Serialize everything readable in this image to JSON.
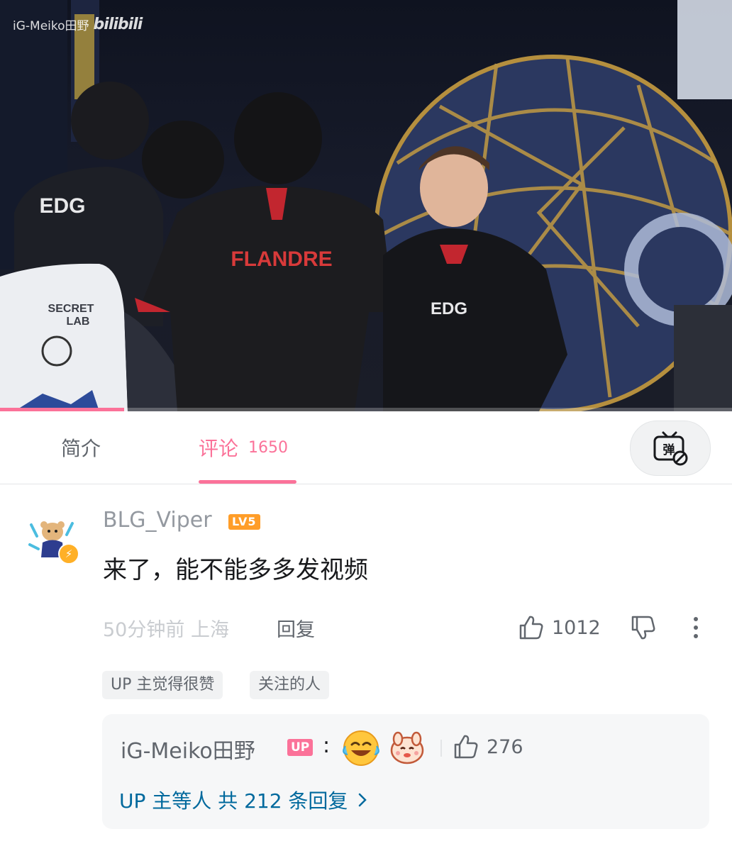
{
  "video": {
    "watermark_user": "iG-Meiko田野",
    "watermark_brand": "bilibili",
    "jersey_name": "FLANDRE",
    "team_logo": "EDG",
    "chair_brand_line1": "SECRET",
    "chair_brand_line2": "LAB",
    "progress_fraction": 0.17
  },
  "tabs": {
    "intro_label": "简介",
    "comments_label": "评论",
    "comments_count": "1650",
    "danmaku_icon": "danmaku-off-icon"
  },
  "comment": {
    "username": "BLG_Viper",
    "level": "LV5",
    "text": "来了，能不能多多发视频",
    "time": "50分钟前",
    "location": "上海",
    "reply_label": "回复",
    "likes": "1012",
    "tags": [
      "UP 主觉得很赞",
      "关注的人"
    ]
  },
  "reply_preview": {
    "name": "iG-Meiko田野",
    "up_badge": "UP",
    "colon": ":",
    "likes": "276",
    "more_text": "UP 主等人 共 212 条回复"
  },
  "colors": {
    "accent": "#fb7299",
    "link": "#00699d",
    "level_badge": "#ff9d28"
  }
}
